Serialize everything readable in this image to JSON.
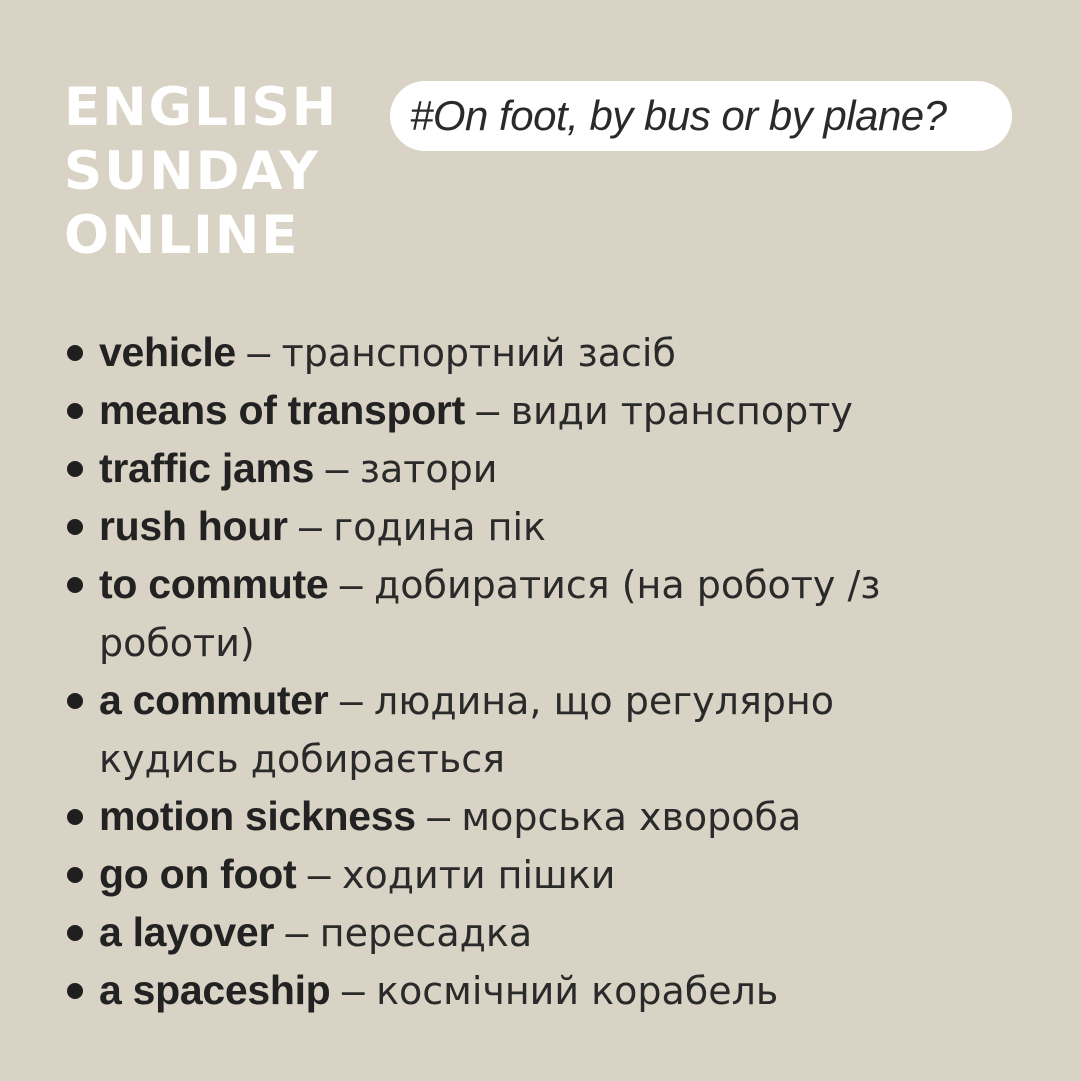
{
  "brand": {
    "line1": "ENGLISH",
    "line2": "SUNDAY",
    "line3": "ONLINE"
  },
  "hashtag": "#On foot, by bus or by plane?",
  "vocabulary": [
    {
      "term": "vehicle",
      "dash": "–",
      "translation": "транспортний засіб"
    },
    {
      "term": "means of transport",
      "dash": "–",
      "translation": "види транспорту"
    },
    {
      "term": "traffic jams",
      "dash": "–",
      "translation": "затори"
    },
    {
      "term": "rush hour",
      "dash": "–",
      "translation": "година пік"
    },
    {
      "term": "to commute",
      "dash": "–",
      "translation": "добиратися (на роботу /з роботи)"
    },
    {
      "term": "a commuter",
      "dash": "–",
      "translation": "людина, що регулярно кудись добирається"
    },
    {
      "term": "motion sickness",
      "dash": "–",
      "translation": "морська хвороба"
    },
    {
      "term": "go on foot",
      "dash": "–",
      "translation": "ходити пішки"
    },
    {
      "term": "a layover",
      "dash": "–",
      "translation": "пересадка"
    },
    {
      "term": "a spaceship",
      "dash": "–",
      "translation": "космічний корабель"
    }
  ],
  "colors": {
    "background": "#d8d3c5",
    "brand_text": "#ffffff",
    "pill_background": "#ffffff",
    "body_text": "#252525"
  }
}
